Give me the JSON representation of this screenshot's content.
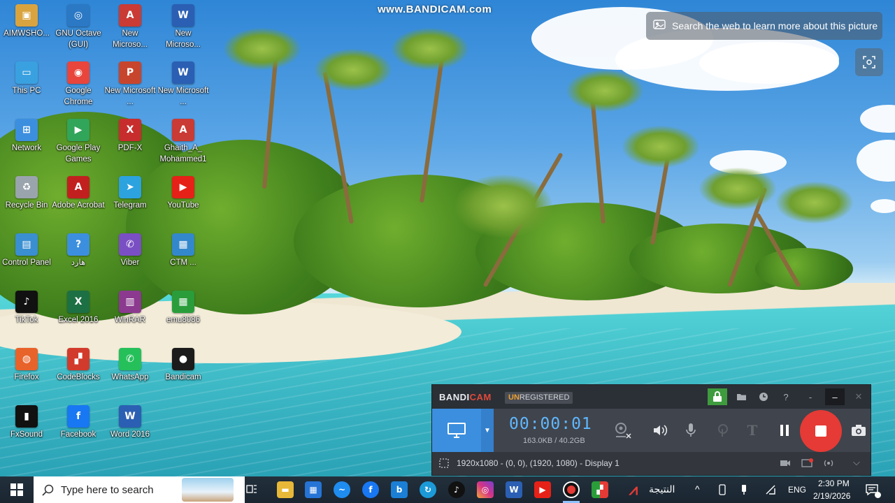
{
  "watermark": "www.BANDICAM.com",
  "search_banner": {
    "text": "Search the web to learn more about this picture"
  },
  "desktop_icons": [
    {
      "label": "AIMWSHO...",
      "color": "#d9a440",
      "glyph": "▣"
    },
    {
      "label": "GNU Octave (GUI)",
      "color": "#2b78c5",
      "glyph": "◎"
    },
    {
      "label": "New Microso...",
      "color": "#c93b34",
      "glyph": "A"
    },
    {
      "label": "New Microso...",
      "color": "#2b5fb3",
      "glyph": "W"
    },
    {
      "label": "This PC",
      "color": "#3aa1e0",
      "glyph": "▭"
    },
    {
      "label": "Google Chrome",
      "color": "#e8453c",
      "glyph": "◉"
    },
    {
      "label": "New Microsoft ...",
      "color": "#c8452d",
      "glyph": "P"
    },
    {
      "label": "New Microsoft ...",
      "color": "#2b5fb3",
      "glyph": "W"
    },
    {
      "label": "Network",
      "color": "#3c8fde",
      "glyph": "⊞"
    },
    {
      "label": "Google Play Games",
      "color": "#31a55a",
      "glyph": "▶"
    },
    {
      "label": "PDF-X",
      "color": "#c82d2d",
      "glyph": "X"
    },
    {
      "label": "Ghaith_A_ Mohammed1",
      "color": "#c93b34",
      "glyph": "A"
    },
    {
      "label": "Recycle Bin",
      "color": "#9aa4ad",
      "glyph": "♻"
    },
    {
      "label": "Adobe Acrobat",
      "color": "#c2201f",
      "glyph": "A"
    },
    {
      "label": "Telegram",
      "color": "#2ca3df",
      "glyph": "➤"
    },
    {
      "label": "YouTube",
      "color": "#e62117",
      "glyph": "▶"
    },
    {
      "label": "Control Panel",
      "color": "#3a8fd1",
      "glyph": "▤"
    },
    {
      "label": "هارد",
      "color": "#3c8fde",
      "glyph": "?"
    },
    {
      "label": "Viber",
      "color": "#7a4fc4",
      "glyph": "✆"
    },
    {
      "label": "CTM ...",
      "color": "#3388cc",
      "glyph": "▦"
    },
    {
      "label": "TikTok",
      "color": "#111111",
      "glyph": "♪"
    },
    {
      "label": "Excel 2016",
      "color": "#1d7044",
      "glyph": "X"
    },
    {
      "label": "WinRAR",
      "color": "#8b3a8f",
      "glyph": "▥"
    },
    {
      "label": "emu8086",
      "color": "#2a9d3a",
      "glyph": "▦"
    },
    {
      "label": "Firefox",
      "color": "#e8632a",
      "glyph": "◍"
    },
    {
      "label": "CodeBlocks",
      "color": "#d23b2c",
      "glyph": "▞"
    },
    {
      "label": "WhatsApp",
      "color": "#25c05a",
      "glyph": "✆"
    },
    {
      "label": "Bandicam",
      "color": "#1b1b1b",
      "glyph": "●"
    },
    {
      "label": "FxSound",
      "color": "#111111",
      "glyph": "▮"
    },
    {
      "label": "Facebook",
      "color": "#1877f2",
      "glyph": "f"
    },
    {
      "label": "Word 2016",
      "color": "#2b5fb3",
      "glyph": "W"
    }
  ],
  "bandicam": {
    "logo_main": "BANDI",
    "logo_accent": "CAM",
    "unreg_prefix": "UN",
    "unreg_rest": "REGISTERED",
    "timer": "00:00:01",
    "file_size": "163.0KB / 40.2GB",
    "status_text": "1920x1080 - (0, 0), (1920, 1080) - Display 1",
    "help": "?",
    "minimize": "–",
    "close": "✕",
    "text_tool": "T",
    "accent_color": "#3c8fde",
    "record_color": "#e53a35"
  },
  "taskbar": {
    "search_placeholder": "Type here to search",
    "arabic_label": "النتيجة",
    "lang": "ENG",
    "time": "2:30 PM",
    "date": "2/19/2026",
    "tray_up": "^"
  }
}
